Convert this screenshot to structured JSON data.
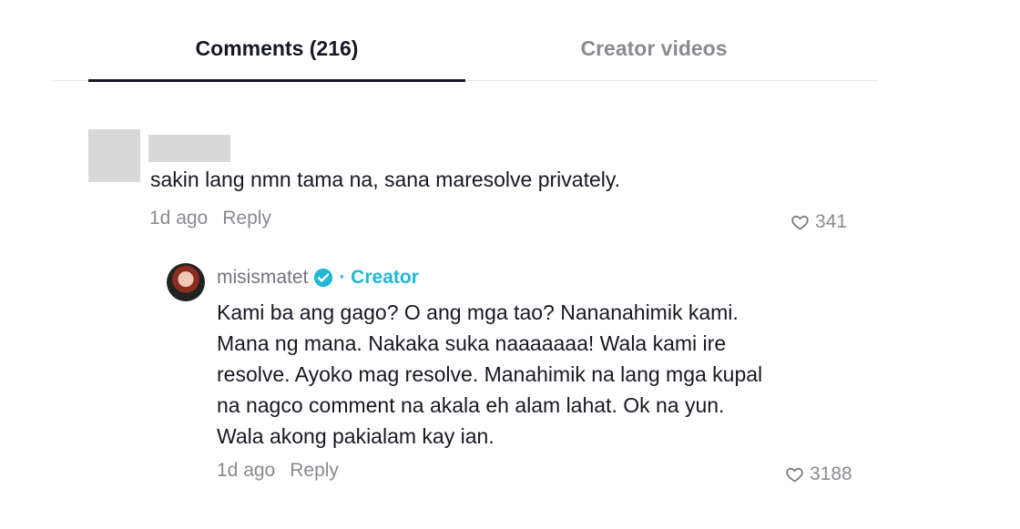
{
  "tabs": [
    {
      "label": "Comments (216)",
      "active": true
    },
    {
      "label": "Creator videos",
      "active": false
    }
  ],
  "comment": {
    "text": "sakin lang nmn tama na, sana maresolve privately.",
    "time": "1d ago",
    "reply_label": "Reply",
    "likes": "341"
  },
  "reply": {
    "username": "misismatet",
    "creator_badge": "· Creator",
    "text": "Kami ba ang gago? O ang mga tao? Nananahimik kami. Mana ng mana. Nakaka suka naaaaaaa! Wala kami ire resolve. Ayoko mag resolve. Manahimik na lang mga kupal na nagco comment na akala eh alam lahat. Ok na yun. Wala akong pakialam kay ian.",
    "time": "1d ago",
    "reply_label": "Reply",
    "likes": "3188"
  },
  "colors": {
    "accent_creator": "#20b7d6",
    "muted": "#8a8b91",
    "text": "#161823"
  },
  "icons": {
    "like": "heart-outline-icon",
    "verified": "verified-check-icon"
  }
}
